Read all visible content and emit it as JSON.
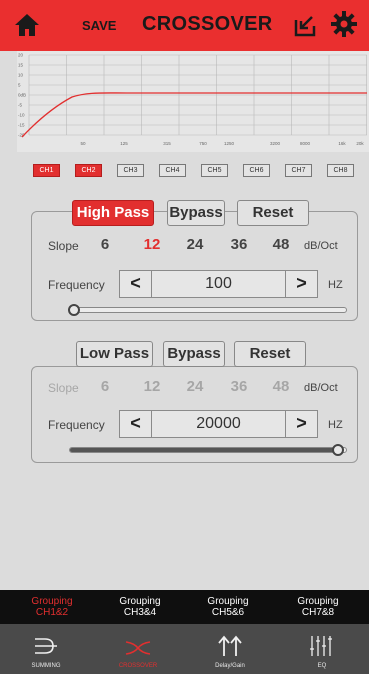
{
  "header": {
    "save_label": "SAVE",
    "title": "CROSSOVER",
    "accent_color": "#ea2f2f",
    "icons": [
      "home-icon",
      "export-icon",
      "gear-icon"
    ]
  },
  "graph": {
    "y_ticks": [
      "20",
      "15",
      "10",
      "5",
      "0dB",
      "-5",
      "-10",
      "-15",
      "-20"
    ],
    "x_ticks": [
      "50",
      "125",
      "315",
      "750",
      "1250",
      "3200",
      "8000",
      "16k",
      "20k"
    ]
  },
  "channels": [
    {
      "label": "CH1",
      "active": true
    },
    {
      "label": "CH2",
      "active": true
    },
    {
      "label": "CH3",
      "active": false
    },
    {
      "label": "CH4",
      "active": false
    },
    {
      "label": "CH5",
      "active": false
    },
    {
      "label": "CH6",
      "active": false
    },
    {
      "label": "CH7",
      "active": false
    },
    {
      "label": "CH8",
      "active": false
    }
  ],
  "highpass": {
    "tab_label": "High Pass",
    "bypass_label": "Bypass",
    "reset_label": "Reset",
    "slope_label": "Slope",
    "slopes": [
      "6",
      "12",
      "24",
      "36",
      "48"
    ],
    "selected_slope": "12",
    "slope_unit": "dB/Oct",
    "frequency_label": "Frequency",
    "dec_label": "<",
    "inc_label": ">",
    "frequency_value": "100",
    "frequency_unit": "HZ",
    "slider_fraction": 0.0
  },
  "lowpass": {
    "tab_label": "Low Pass",
    "bypass_label": "Bypass",
    "reset_label": "Reset",
    "slope_label": "Slope",
    "slopes": [
      "6",
      "12",
      "24",
      "36",
      "48"
    ],
    "slope_unit": "dB/Oct",
    "frequency_label": "Frequency",
    "dec_label": "<",
    "inc_label": ">",
    "frequency_value": "20000",
    "frequency_unit": "HZ",
    "slider_fraction": 1.0
  },
  "grouping": [
    {
      "line1": "Grouping",
      "line2": "CH1&2",
      "active": true
    },
    {
      "line1": "Grouping",
      "line2": "CH3&4",
      "active": false
    },
    {
      "line1": "Grouping",
      "line2": "CH5&6",
      "active": false
    },
    {
      "line1": "Grouping",
      "line2": "CH7&8",
      "active": false
    }
  ],
  "nav": [
    {
      "label": "SUMMING",
      "icon": "summing-icon",
      "active": false
    },
    {
      "label": "CROSSOVER",
      "icon": "crossover-icon",
      "active": true
    },
    {
      "label": "Delay/Gain",
      "icon": "delay-gain-icon",
      "active": false
    },
    {
      "label": "EQ",
      "icon": "eq-icon",
      "active": false
    }
  ]
}
